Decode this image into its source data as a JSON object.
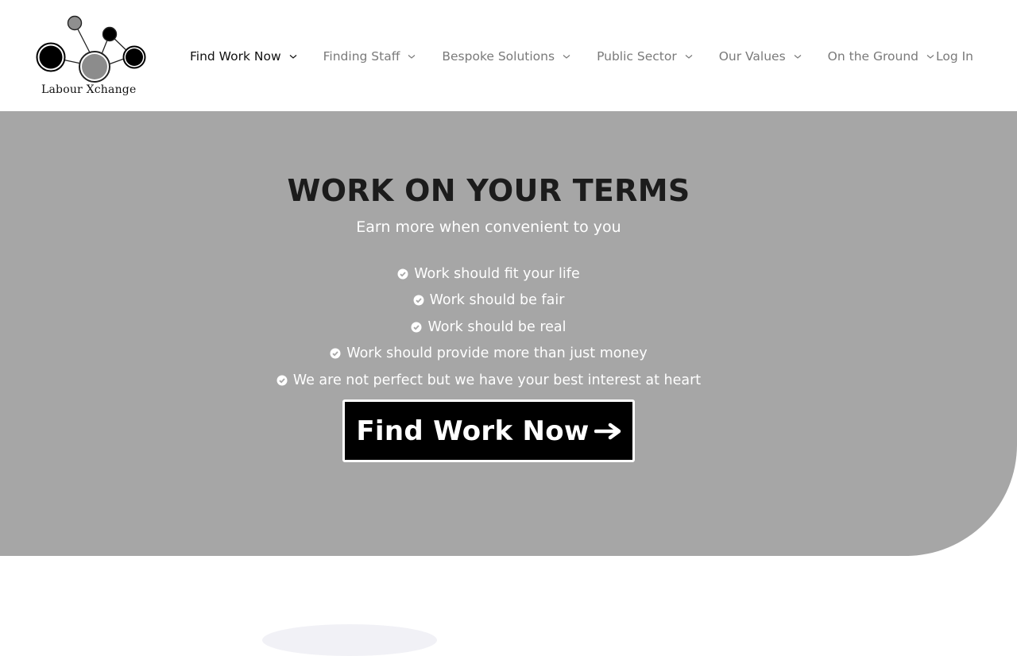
{
  "brand": {
    "name": "Labour Xchange",
    "logo_icon": "network-nodes-logo"
  },
  "nav": {
    "items": [
      {
        "label": "Find Work Now",
        "active": true,
        "icon": "chevron-down-icon"
      },
      {
        "label": "Finding Staff",
        "active": false,
        "icon": "chevron-down-icon"
      },
      {
        "label": "Bespoke Solutions",
        "active": false,
        "icon": "chevron-down-icon"
      },
      {
        "label": "Public Sector",
        "active": false,
        "icon": "chevron-down-icon"
      },
      {
        "label": "Our Values",
        "active": false,
        "icon": "chevron-down-icon"
      },
      {
        "label": "On the Ground",
        "active": false,
        "icon": "chevron-down-icon"
      }
    ],
    "login_label": "Log In"
  },
  "hero": {
    "title": "WORK ON YOUR TERMS",
    "subtitle": "Earn more when convenient to you",
    "points": [
      "Work should fit your life",
      "Work should be fair",
      "Work should be real",
      "Work should provide more than just money",
      "We are not perfect but we have your best interest at heart"
    ],
    "point_icon": "check-circle-icon",
    "cta_label": "Find Work Now",
    "cta_icon": "arrow-right-icon"
  },
  "colors": {
    "hero_bg": "#a6a6a6",
    "nav_active": "#111111",
    "nav_inactive": "#7a7a7a",
    "cta_bg": "#000000"
  }
}
